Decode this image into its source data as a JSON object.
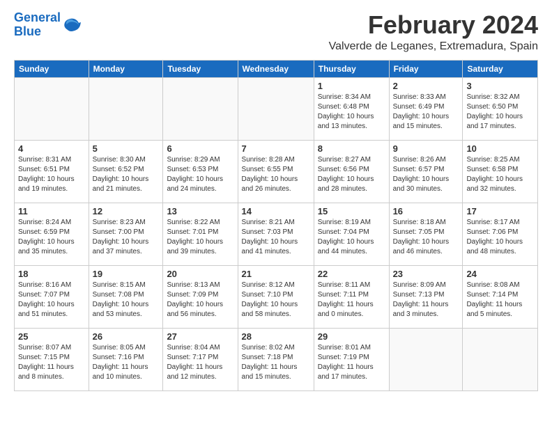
{
  "logo": {
    "line1": "General",
    "line2": "Blue"
  },
  "title": "February 2024",
  "location": "Valverde de Leganes, Extremadura, Spain",
  "headers": [
    "Sunday",
    "Monday",
    "Tuesday",
    "Wednesday",
    "Thursday",
    "Friday",
    "Saturday"
  ],
  "weeks": [
    [
      {
        "day": "",
        "info": ""
      },
      {
        "day": "",
        "info": ""
      },
      {
        "day": "",
        "info": ""
      },
      {
        "day": "",
        "info": ""
      },
      {
        "day": "1",
        "info": "Sunrise: 8:34 AM\nSunset: 6:48 PM\nDaylight: 10 hours\nand 13 minutes."
      },
      {
        "day": "2",
        "info": "Sunrise: 8:33 AM\nSunset: 6:49 PM\nDaylight: 10 hours\nand 15 minutes."
      },
      {
        "day": "3",
        "info": "Sunrise: 8:32 AM\nSunset: 6:50 PM\nDaylight: 10 hours\nand 17 minutes."
      }
    ],
    [
      {
        "day": "4",
        "info": "Sunrise: 8:31 AM\nSunset: 6:51 PM\nDaylight: 10 hours\nand 19 minutes."
      },
      {
        "day": "5",
        "info": "Sunrise: 8:30 AM\nSunset: 6:52 PM\nDaylight: 10 hours\nand 21 minutes."
      },
      {
        "day": "6",
        "info": "Sunrise: 8:29 AM\nSunset: 6:53 PM\nDaylight: 10 hours\nand 24 minutes."
      },
      {
        "day": "7",
        "info": "Sunrise: 8:28 AM\nSunset: 6:55 PM\nDaylight: 10 hours\nand 26 minutes."
      },
      {
        "day": "8",
        "info": "Sunrise: 8:27 AM\nSunset: 6:56 PM\nDaylight: 10 hours\nand 28 minutes."
      },
      {
        "day": "9",
        "info": "Sunrise: 8:26 AM\nSunset: 6:57 PM\nDaylight: 10 hours\nand 30 minutes."
      },
      {
        "day": "10",
        "info": "Sunrise: 8:25 AM\nSunset: 6:58 PM\nDaylight: 10 hours\nand 32 minutes."
      }
    ],
    [
      {
        "day": "11",
        "info": "Sunrise: 8:24 AM\nSunset: 6:59 PM\nDaylight: 10 hours\nand 35 minutes."
      },
      {
        "day": "12",
        "info": "Sunrise: 8:23 AM\nSunset: 7:00 PM\nDaylight: 10 hours\nand 37 minutes."
      },
      {
        "day": "13",
        "info": "Sunrise: 8:22 AM\nSunset: 7:01 PM\nDaylight: 10 hours\nand 39 minutes."
      },
      {
        "day": "14",
        "info": "Sunrise: 8:21 AM\nSunset: 7:03 PM\nDaylight: 10 hours\nand 41 minutes."
      },
      {
        "day": "15",
        "info": "Sunrise: 8:19 AM\nSunset: 7:04 PM\nDaylight: 10 hours\nand 44 minutes."
      },
      {
        "day": "16",
        "info": "Sunrise: 8:18 AM\nSunset: 7:05 PM\nDaylight: 10 hours\nand 46 minutes."
      },
      {
        "day": "17",
        "info": "Sunrise: 8:17 AM\nSunset: 7:06 PM\nDaylight: 10 hours\nand 48 minutes."
      }
    ],
    [
      {
        "day": "18",
        "info": "Sunrise: 8:16 AM\nSunset: 7:07 PM\nDaylight: 10 hours\nand 51 minutes."
      },
      {
        "day": "19",
        "info": "Sunrise: 8:15 AM\nSunset: 7:08 PM\nDaylight: 10 hours\nand 53 minutes."
      },
      {
        "day": "20",
        "info": "Sunrise: 8:13 AM\nSunset: 7:09 PM\nDaylight: 10 hours\nand 56 minutes."
      },
      {
        "day": "21",
        "info": "Sunrise: 8:12 AM\nSunset: 7:10 PM\nDaylight: 10 hours\nand 58 minutes."
      },
      {
        "day": "22",
        "info": "Sunrise: 8:11 AM\nSunset: 7:11 PM\nDaylight: 11 hours\nand 0 minutes."
      },
      {
        "day": "23",
        "info": "Sunrise: 8:09 AM\nSunset: 7:13 PM\nDaylight: 11 hours\nand 3 minutes."
      },
      {
        "day": "24",
        "info": "Sunrise: 8:08 AM\nSunset: 7:14 PM\nDaylight: 11 hours\nand 5 minutes."
      }
    ],
    [
      {
        "day": "25",
        "info": "Sunrise: 8:07 AM\nSunset: 7:15 PM\nDaylight: 11 hours\nand 8 minutes."
      },
      {
        "day": "26",
        "info": "Sunrise: 8:05 AM\nSunset: 7:16 PM\nDaylight: 11 hours\nand 10 minutes."
      },
      {
        "day": "27",
        "info": "Sunrise: 8:04 AM\nSunset: 7:17 PM\nDaylight: 11 hours\nand 12 minutes."
      },
      {
        "day": "28",
        "info": "Sunrise: 8:02 AM\nSunset: 7:18 PM\nDaylight: 11 hours\nand 15 minutes."
      },
      {
        "day": "29",
        "info": "Sunrise: 8:01 AM\nSunset: 7:19 PM\nDaylight: 11 hours\nand 17 minutes."
      },
      {
        "day": "",
        "info": ""
      },
      {
        "day": "",
        "info": ""
      }
    ]
  ]
}
